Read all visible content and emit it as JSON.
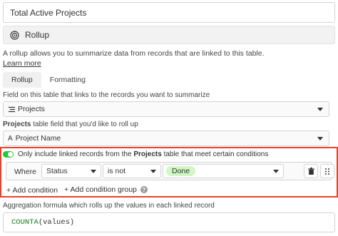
{
  "field_name": {
    "value": "Total Active Projects"
  },
  "field_type": {
    "label": "Rollup",
    "icon": "rollup-icon"
  },
  "description": {
    "text": "A rollup allows you to summarize data from records that are linked to this table.",
    "learn_more": "Learn more"
  },
  "tabs": [
    {
      "label": "Rollup",
      "active": true
    },
    {
      "label": "Formatting",
      "active": false
    }
  ],
  "link_field": {
    "label": "Field on this table that links to the records you want to summarize",
    "value": "Projects",
    "icon": "list-link-icon"
  },
  "rollup_field": {
    "label_bold": "Projects",
    "label_rest": "table field that you'd like to roll up",
    "value": "Project Name",
    "icon_glyph": "A"
  },
  "conditions": {
    "toggle_on": true,
    "label_prefix": "Only include linked records from the",
    "label_bold": "Projects",
    "label_suffix": "table that meet certain conditions",
    "where_label": "Where",
    "field": "Status",
    "operator": "is not",
    "value_chip": "Done",
    "add_condition": "+ Add condition",
    "add_condition_group": "+ Add condition group",
    "highlight_color": "#e8412c",
    "toggle_color": "#20c933",
    "chip_color": "#d1f7c4"
  },
  "aggregation": {
    "label": "Aggregation formula which rolls up the values in each linked record",
    "formula_fn": "COUNTA",
    "formula_args": "(values)"
  }
}
